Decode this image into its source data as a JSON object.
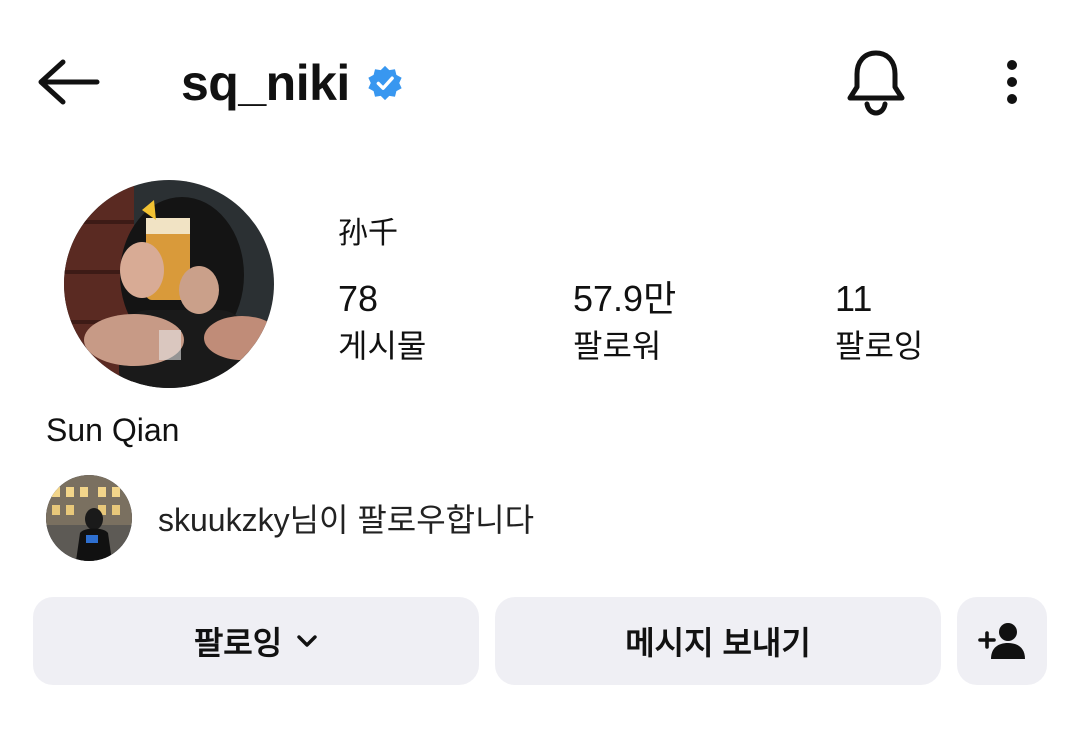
{
  "header": {
    "username": "sq_niki",
    "verified_icon": "verified-badge-icon",
    "back_icon": "arrow-left-icon",
    "notification_icon": "bell-icon",
    "more_icon": "more-vertical-icon"
  },
  "profile": {
    "display_name_zh": "孙千",
    "full_name": "Sun Qian",
    "stats": {
      "posts": {
        "count": "78",
        "label": "게시물"
      },
      "followers": {
        "count": "57.9만",
        "label": "팔로워"
      },
      "following": {
        "count": "11",
        "label": "팔로잉"
      }
    },
    "mutual_follow_text": "skuukzky님이 팔로우합니다"
  },
  "actions": {
    "following_label": "팔로잉",
    "following_icon": "chevron-down-icon",
    "message_label": "메시지 보내기",
    "add_person_icon": "add-person-icon"
  },
  "colors": {
    "verified": "#3897f0",
    "button_bg": "#efeff4",
    "text": "#111111"
  }
}
